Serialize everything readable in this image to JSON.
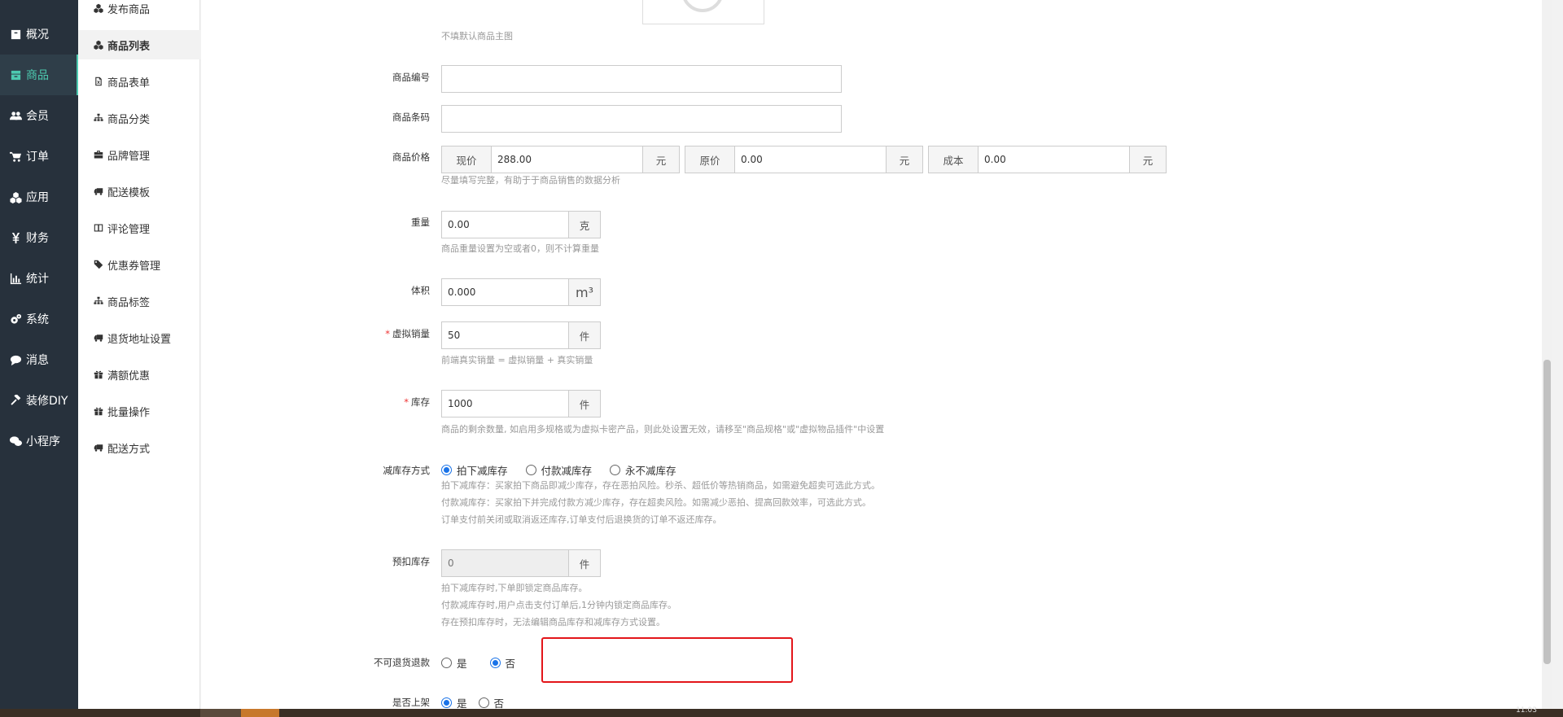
{
  "primary_nav": [
    {
      "label": "概况",
      "icon": "box-icon"
    },
    {
      "label": "商品",
      "icon": "store-icon",
      "active": true
    },
    {
      "label": "会员",
      "icon": "users-icon"
    },
    {
      "label": "订单",
      "icon": "cart-icon"
    },
    {
      "label": "应用",
      "icon": "cubes-icon"
    },
    {
      "label": "财务",
      "icon": "yen-icon"
    },
    {
      "label": "统计",
      "icon": "bar-chart-icon"
    },
    {
      "label": "系统",
      "icon": "gears-icon"
    },
    {
      "label": "消息",
      "icon": "comment-icon"
    },
    {
      "label": "装修DIY",
      "icon": "gavel-icon"
    },
    {
      "label": "小程序",
      "icon": "wechat-icon"
    }
  ],
  "secondary_nav": [
    {
      "label": "发布商品",
      "icon": "cubes-icon"
    },
    {
      "label": "商品列表",
      "icon": "cubes-icon",
      "active": true
    },
    {
      "label": "商品表单",
      "icon": "file-excel-icon"
    },
    {
      "label": "商品分类",
      "icon": "sitemap-icon"
    },
    {
      "label": "品牌管理",
      "icon": "briefcase-icon"
    },
    {
      "label": "配送模板",
      "icon": "truck-icon"
    },
    {
      "label": "评论管理",
      "icon": "columns-icon"
    },
    {
      "label": "优惠券管理",
      "icon": "tags-icon"
    },
    {
      "label": "商品标签",
      "icon": "sitemap-icon"
    },
    {
      "label": "退货地址设置",
      "icon": "truck-icon"
    },
    {
      "label": "满额优惠",
      "icon": "gift-icon"
    },
    {
      "label": "批量操作",
      "icon": "gift-icon"
    },
    {
      "label": "配送方式",
      "icon": "truck-icon"
    }
  ],
  "form": {
    "image_hint": "不填默认商品主图",
    "goods_sn": {
      "label": "商品编号",
      "value": ""
    },
    "barcode": {
      "label": "商品条码",
      "value": ""
    },
    "price": {
      "label": "商品价格",
      "current_prefix": "现价",
      "current_value": "288.00",
      "current_suffix": "元",
      "original_prefix": "原价",
      "original_value": "0.00",
      "original_suffix": "元",
      "cost_prefix": "成本",
      "cost_value": "0.00",
      "cost_suffix": "元",
      "hint": "尽量填写完整，有助于于商品销售的数据分析"
    },
    "weight": {
      "label": "重量",
      "value": "0.00",
      "unit": "克",
      "hint": "商品重量设置为空或者0，则不计算重量"
    },
    "volume": {
      "label": "体积",
      "value": "0.000",
      "unit": "m³"
    },
    "virtual_sales": {
      "label": "虚拟销量",
      "required": "*",
      "value": "50",
      "unit": "件",
      "hint": "前端真实销量 = 虚拟销量 + 真实销量"
    },
    "stock": {
      "label": "库存",
      "required": "*",
      "value": "1000",
      "unit": "件",
      "hint": "商品的剩余数量, 如启用多规格或为虚拟卡密产品，则此处设置无效，请移至\"商品规格\"或\"虚拟物品插件\"中设置"
    },
    "stock_mode": {
      "label": "减库存方式",
      "options": [
        "拍下减库存",
        "付款减库存",
        "永不减库存"
      ],
      "selected": 0,
      "hints": [
        "拍下减库存：买家拍下商品即减少库存，存在恶拍风险。秒杀、超低价等热销商品，如需避免超卖可选此方式。",
        "付款减库存：买家拍下并完成付款方减少库存，存在超卖风险。如需减少恶拍、提高回款效率，可选此方式。",
        "订单支付前关闭或取消返还库存,订单支付后退换货的订单不返还库存。"
      ]
    },
    "pre_stock": {
      "label": "预扣库存",
      "value": "0",
      "unit": "件",
      "hints": [
        "拍下减库存时,下单即锁定商品库存。",
        "付款减库存时,用户点击支付订单后,1分钟内锁定商品库存。",
        "存在预扣库存时，无法编辑商品库存和减库存方式设置。"
      ]
    },
    "no_refund": {
      "label": "不可退货退款",
      "options": [
        "是",
        "否"
      ],
      "selected": 1
    },
    "on_sale": {
      "label": "是否上架",
      "options": [
        "是",
        "否"
      ],
      "selected": 0
    }
  },
  "taskbar": {
    "time": "11:03"
  },
  "colors": {
    "sidebar_bg": "#27313c",
    "accent": "#4dcab0",
    "highlight_border": "#e3151a",
    "radio": "#1a73e8"
  }
}
